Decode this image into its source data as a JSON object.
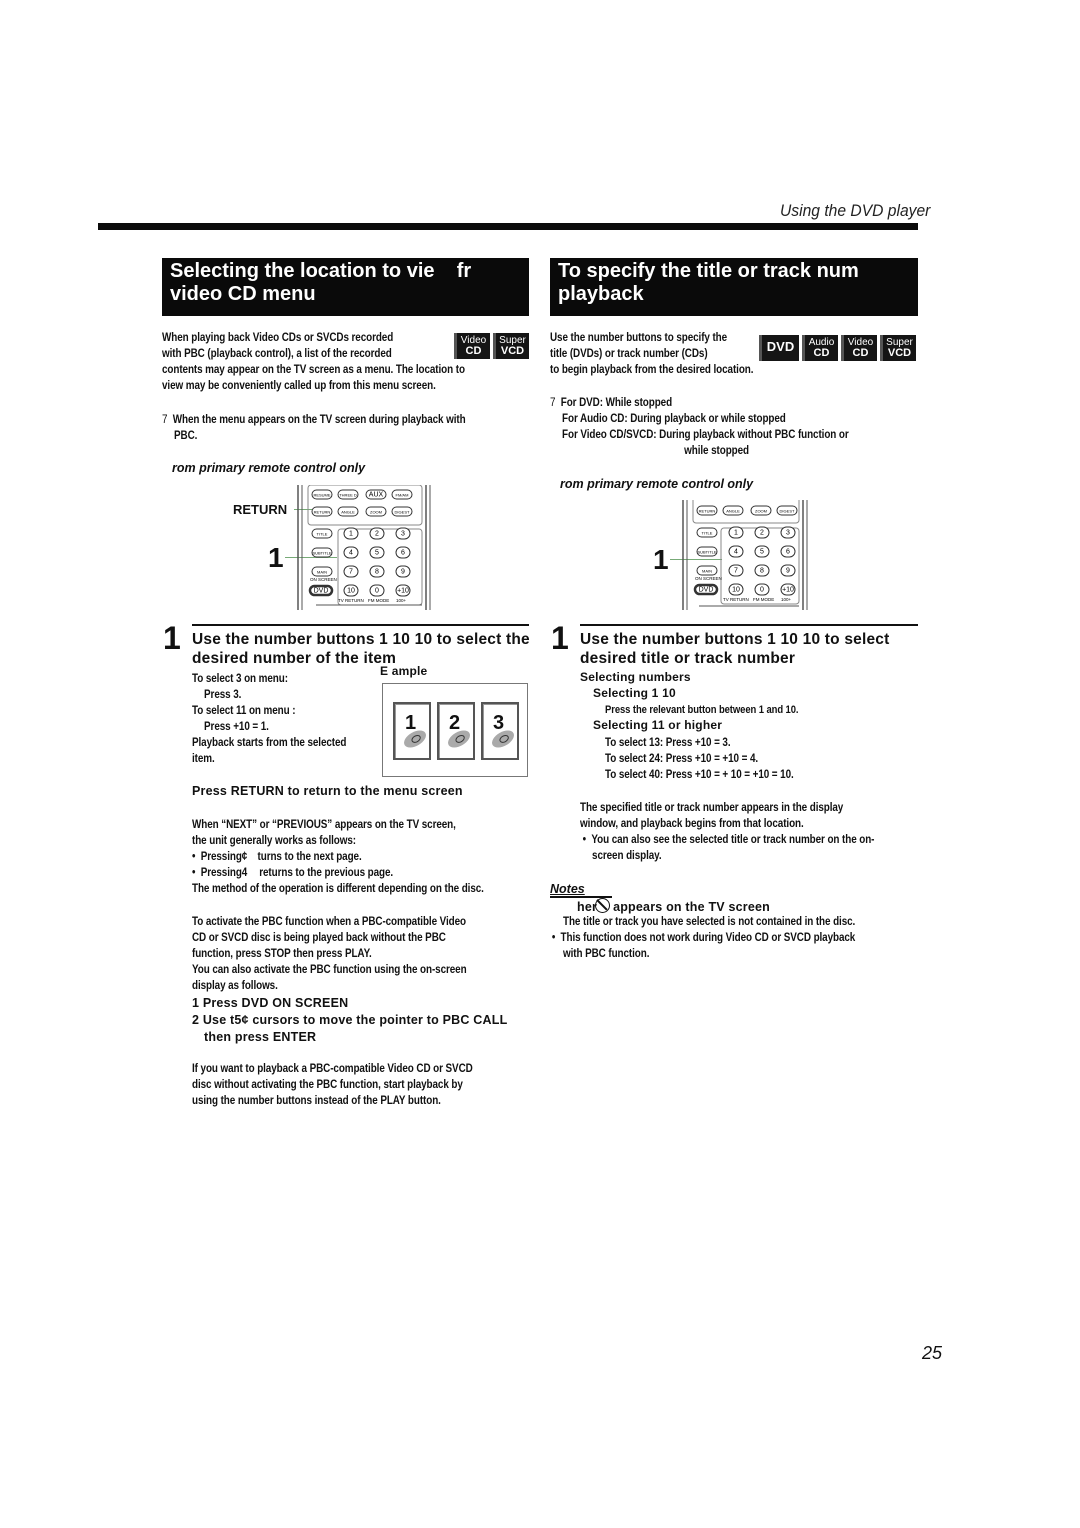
{
  "header": {
    "title": "Using the DVD player"
  },
  "left": {
    "section_title_line1": "Selecting the location to vie    fr",
    "section_title_line2": "video CD menu",
    "intro_line1": "When playing back Video CDs or SVCDs recorded",
    "intro_line2": "with PBC (playback control), a list of the recorded",
    "intro_line3": "contents may appear on the TV screen as a menu. The location to",
    "intro_line4": "view may be conveniently called up from this menu screen.",
    "badges": [
      {
        "top": "Video",
        "bottom": "CD"
      },
      {
        "top": "Super",
        "bottom": "VCD"
      }
    ],
    "condition_marker": "7",
    "condition_line1": "When the menu appears on the TV screen during playback with",
    "condition_line2": "PBC.",
    "remote_label": "rom primary remote control only",
    "remote_callouts": {
      "return": "RETURN",
      "step": "1"
    },
    "step1": {
      "number": "1",
      "heading_line1": "Use the number buttons  1  10    10  to select the",
      "heading_line2": "desired number of the item",
      "example_label": "E  ample",
      "lines": [
        "To select 3 on menu:",
        "Press 3.",
        "To select 11 on menu :",
        "Press +10 =  1.",
        "Playback starts from the selected",
        "item."
      ],
      "example_cards": [
        "1",
        "2",
        "3"
      ]
    },
    "return_heading": "Press RETURN to return to the menu screen",
    "next_prev_line1": "When “NEXT” or “PREVIOUS” appears on the TV screen,",
    "next_prev_line2": "the unit generally works as follows:",
    "bullets": [
      {
        "action": "Pressing¢",
        "result": "turns to the next page."
      },
      {
        "action": "Pressing4",
        "result": "returns to the previous page."
      }
    ],
    "method_note": "The method of the operation is different depending on the disc.",
    "pbc_para": [
      "To activate the PBC function when a PBC-compatible Video",
      "CD or SVCD disc is being played back without the PBC",
      "function, press STOP then press PLAY.",
      "You can also activate the PBC function using the on-screen",
      "display as follows."
    ],
    "pbc_steps": [
      "1  Press DVD ON SCREEN",
      "2  Use t5¢    cursors to move the pointer to  PBC CALL",
      "then press ENTER"
    ],
    "final_para": [
      "If you want to playback a PBC-compatible Video CD or SVCD",
      "disc without activating the PBC function, start playback by",
      "using the number buttons instead of the PLAY button."
    ]
  },
  "right": {
    "section_title_line1": "To specify the title or track num",
    "section_title_line2": "playback",
    "intro_line1": "Use the number buttons to specify the",
    "intro_line2": "title (DVDs) or track number (CDs)",
    "intro_line3": "to begin playback from the desired location.",
    "badges": [
      {
        "top": "",
        "bottom": "DVD"
      },
      {
        "top": "Audio",
        "bottom": "CD"
      },
      {
        "top": "Video",
        "bottom": "CD"
      },
      {
        "top": "Super",
        "bottom": "VCD"
      }
    ],
    "condition_marker": "7",
    "conditions": [
      "For DVD: While stopped",
      "For Audio CD: During playback or while stopped",
      "For Video CD/SVCD: During playback without PBC function or",
      "while stopped"
    ],
    "remote_label": "rom primary remote control only",
    "remote_callouts": {
      "step": "1"
    },
    "step1": {
      "number": "1",
      "heading_line1": "Use the number buttons  1  10    10  to select",
      "heading_line2": "desired title or track number",
      "sub_heading": "Selecting numbers",
      "sub1_heading": "Selecting 1  10",
      "sub1_text": "Press the relevant button between 1 and 10.",
      "sub2_heading": "Selecting 11 or higher",
      "sub2_lines": [
        "To select 13: Press +10 =  3.",
        "To select 24: Press +10 =  +10 =  4.",
        "To select 40: Press +10 =  + 10 =  +10 =  10."
      ]
    },
    "result_line1": "The specified title or track number appears in the display",
    "result_line2": "window, and playback begins from that location.",
    "result_bullet_line1": "You can also see the selected title or track number on the on-",
    "result_bullet_line2": "screen display.",
    "notes": {
      "label": "Notes",
      "heading_prefix": "her",
      "heading_suffix": "appears on the TV screen",
      "line1": "The title or track you have selected is not contained in the disc.",
      "bullet_line1": "This function does not work during Video CD or SVCD playback",
      "bullet_line2": "with PBC function."
    }
  },
  "remote_buttons": {
    "row_top": [
      "RESUME",
      "THREE D",
      "AUX",
      "FM/AM"
    ],
    "row_return": [
      "RETURN",
      "ANGLE",
      "ZOOM",
      "DIGEST"
    ],
    "side": [
      "TITLE",
      "SUBTITLE",
      "MAIN"
    ],
    "numbers": [
      "1",
      "2",
      "3",
      "4",
      "5",
      "6",
      "7",
      "8",
      "9",
      "10",
      "0",
      "+10"
    ],
    "on_screen_label": "ON SCREEN",
    "dvd_label": "DVD",
    "sub_labels": [
      "TV RETURN",
      "FM MODE",
      "100+"
    ]
  },
  "page_number": "25"
}
